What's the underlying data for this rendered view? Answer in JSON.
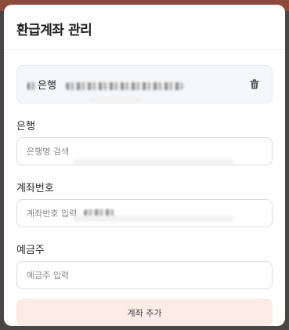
{
  "dialog": {
    "title": "환급계좌 관리"
  },
  "saved_account": {
    "bank_name": "은행",
    "delete_icon": "trash-icon"
  },
  "form": {
    "bank": {
      "label": "은행",
      "placeholder": "은행명 검색"
    },
    "account_number": {
      "label": "계좌번호",
      "placeholder": "계좌번호 입력"
    },
    "holder": {
      "label": "예금주",
      "placeholder": "예금주 입력"
    },
    "submit_label": "계좌 추가"
  },
  "colors": {
    "submit_bg": "#fdebe7",
    "card_bg": "#f5f6f8"
  }
}
